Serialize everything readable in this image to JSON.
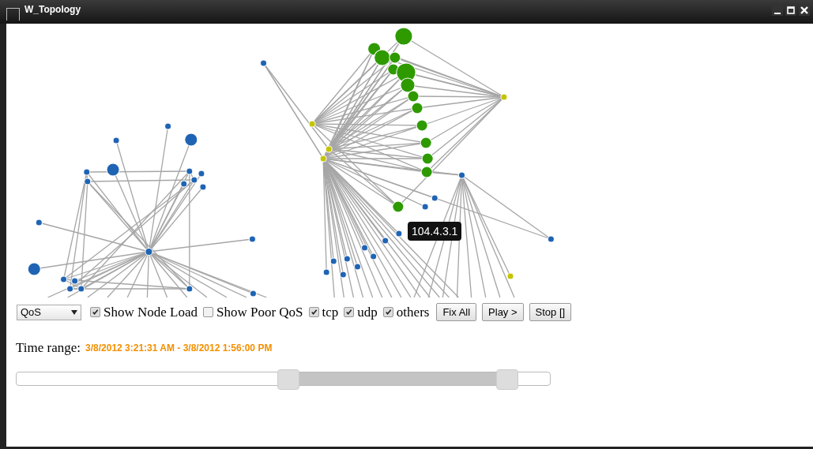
{
  "window": {
    "title": "W_Topology"
  },
  "graph": {
    "tooltip": "104.4.3.1"
  },
  "controls": {
    "select": {
      "value": "QoS"
    },
    "checkboxes": [
      {
        "label": "Show Node Load",
        "checked": true
      },
      {
        "label": "Show Poor QoS",
        "checked": false
      },
      {
        "label": "tcp",
        "checked": true
      },
      {
        "label": "udp",
        "checked": true
      },
      {
        "label": "others",
        "checked": true
      }
    ],
    "buttons": [
      "Fix All",
      "Play >",
      "Stop []"
    ]
  },
  "time_range": {
    "label": "Time range:",
    "value": "3/8/2012 3:21:31 AM - 3/8/2012 1:56:00 PM"
  },
  "range_slider": {
    "handles": [
      {
        "level": 0.51
      },
      {
        "level": 0.92
      }
    ]
  }
}
